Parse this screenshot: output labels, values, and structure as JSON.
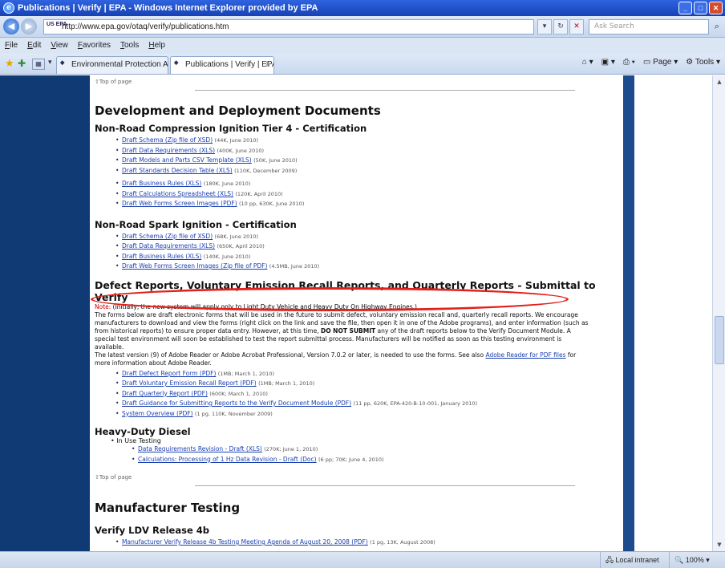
{
  "window": {
    "title": "Publications | Verify | EPA - Windows Internet Explorer provided by EPA"
  },
  "address": {
    "url": "http://www.epa.gov/otaq/verify/publications.htm",
    "favicon": "US EPA",
    "search_placeholder": "Ask Search"
  },
  "menu": [
    "File",
    "Edit",
    "View",
    "Favorites",
    "Tools",
    "Help"
  ],
  "tabs": [
    {
      "label": "Environmental Protection Ag..."
    },
    {
      "label": "Publications | Verify | EPA",
      "close": "X"
    }
  ],
  "commands": {
    "page": "Page",
    "tools": "Tools"
  },
  "content": {
    "top_of_page": "⇧Top of page",
    "dev_heading": "Development and Deployment Documents",
    "nrci": {
      "heading": "Non-Road Compression Ignition Tier 4 - Certification",
      "group1": [
        {
          "link": "Draft Schema (Zip file of XSD)",
          "meta": "(44K, June 2010)"
        },
        {
          "link": "Draft Data Requirements (XLS)",
          "meta": "(400K, June 2010)"
        },
        {
          "link": "Draft Models and Parts CSV Template (XLS)",
          "meta": "(50K, June 2010)"
        },
        {
          "link": "Draft Standards Decision Table (XLS)",
          "meta": "(110K, December 2009)"
        }
      ],
      "group2": [
        {
          "link": "Draft Business Rules (XLS)",
          "meta": "(180K, June 2010)"
        },
        {
          "link": "Draft Calculations Spreadsheet (XLS)",
          "meta": "(120K, April 2010)"
        },
        {
          "link": "Draft Web Forms Screen Images (PDF)",
          "meta": "(10 pp, 630K, June 2010)"
        }
      ]
    },
    "nrsi": {
      "heading": "Non-Road Spark Ignition - Certification",
      "items": [
        {
          "link": "Draft Schema (Zip file of XSD)",
          "meta": "(68K, June 2010)"
        },
        {
          "link": "Draft Data Requirements (XLS)",
          "meta": "(650K, April 2010)"
        },
        {
          "link": "Draft Business Rules (XLS)",
          "meta": "(140K, June 2010)"
        },
        {
          "link": "Draft Web Forms Screen Images (Zip file of PDF)",
          "meta": "(4.5MB, June 2010)"
        }
      ]
    },
    "defect": {
      "heading": "Defect Reports, Voluntary Emission Recall Reports, and Quarterly Reports - Submittal to Verify",
      "note_label": "Note:",
      "note_text": "(Initially, the new system will apply only to Light Duty Vehicle and Heavy Duty On Highway Engines.)",
      "body_1": "The forms below are draft electronic forms that will be used in the future to submit defect, voluntary emission recall and, quarterly recall reports. We encourage manufacturers to download and view the forms (right click on the link and save the file, then open it in one of the Adobe programs), and enter information (such as from historical reports) to ensure proper data entry. However, at this time,",
      "body_bold": "DO NOT SUBMIT",
      "body_2": "any of the draft reports below to the Verify Document Module. A special test environment will soon be established to test the report submittal process. Manufacturers will be notified as soon as this testing environment is available.",
      "body_3": "The latest version (9) of Adobe Reader or Adobe Acrobat Professional, Version 7.0.2 or later, is needed to use the forms. See also",
      "body_link": "Adobe Reader for PDF files",
      "body_4": "for more information about Adobe Reader.",
      "items": [
        {
          "link": "Draft Defect Report Form (PDF)",
          "meta": "(1MB; March 1, 2010)"
        },
        {
          "link": "Draft Voluntary Emission Recall Report (PDF)",
          "meta": "(1MB; March 1, 2010)"
        },
        {
          "link": "Draft Quarterly Report (PDF)",
          "meta": "(600K; March 1, 2010)"
        },
        {
          "link": "Draft Guidance for Submitting Reports to the Verify Document Module (PDF)",
          "meta": "(11 pp, 620K, EPA-420-B-10-001, January 2010)"
        },
        {
          "link": "System Overview (PDF)",
          "meta": "(1 pg, 110K, November 2009)"
        }
      ]
    },
    "hdd": {
      "heading": "Heavy-Duty Diesel",
      "sub": "In Use Testing",
      "items": [
        {
          "link": "Data Requirements Revision - Draft (XLS)",
          "meta": "(270K; June 1, 2010)"
        },
        {
          "link": "Calculations: Processing of 1 Hz Data Revision - Draft (Doc)",
          "meta": "(6 pp; 70K; June 4, 2010)"
        }
      ]
    },
    "top_of_page_2": "⇧Top of page",
    "mfg_heading": "Manufacturer Testing",
    "ldv": {
      "heading": "Verify LDV Release 4b",
      "items": [
        {
          "link": "Manufacturer Verify Release 4b Testing Meeting Agenda of August 20, 2008 (PDF)",
          "meta": "(1 pg, 13K, August 2008)"
        }
      ]
    }
  },
  "status": {
    "zone": "Local intranet",
    "zoom": "100%"
  },
  "colors": {
    "nav": "#103a73",
    "link": "#1a3fb0",
    "annotation": "#e2201a"
  }
}
